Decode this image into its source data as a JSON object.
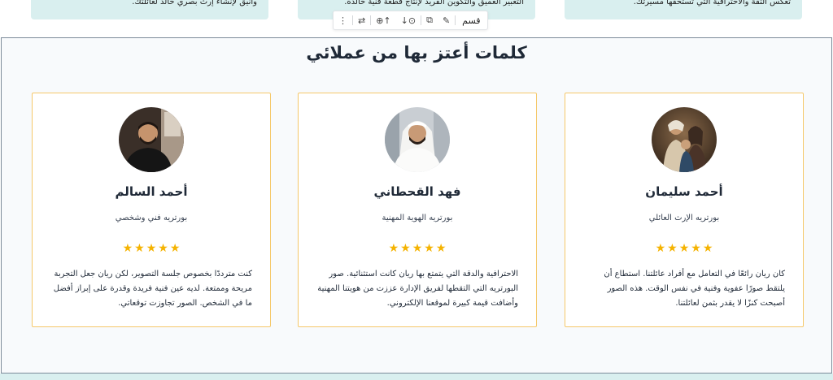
{
  "top_cards": [
    {
      "text": "تعكس الثقة والاحترافية التي تستحقها مسيرتك."
    },
    {
      "text": "التعبير العميق والتكوين الفريد لإنتاج قطعة فنية خالدة."
    },
    {
      "text": "وأنيق لإنشاء إرث بصري خالد لعائلتك."
    }
  ],
  "toolbar": {
    "label": "قسم",
    "edit_icon": "✎",
    "duplicate_icon": "⧉",
    "move_down_icon": "↓⊙",
    "move_up_icon": "⊕↑",
    "swap_icon": "⇄",
    "more_icon": "⋮"
  },
  "section": {
    "title": "كلمات أعتز بها من عملائي"
  },
  "testimonials": [
    {
      "name": "أحمد سليمان",
      "role": "بورتريه الإرث العائلي",
      "rating": 5,
      "quote": "كان ريان رائعًا في التعامل مع أفراد عائلتنا. استطاع أن يلتقط صورًا عفوية وفنية في نفس الوقت. هذه الصور أصبحت كنزًا لا يقدر بثمن لعائلتنا.",
      "avatar": "family-portrait-avatar"
    },
    {
      "name": "فهد القحطاني",
      "role": "بورتريه الهوية المهنية",
      "rating": 5,
      "quote": "الاحترافية والدقة التي يتمتع بها ريان كانت استثنائية. صور البورتريه التي التقطها لفريق الإدارة عززت من هويتنا المهنية وأضافت قيمة كبيرة لموقعنا الإلكتروني.",
      "avatar": "businessman-avatar"
    },
    {
      "name": "أحمد السالم",
      "role": "بورتريه فني وشخصي",
      "rating": 5,
      "quote": "كنت مترددًا بخصوص جلسة التصوير، لكن ريان جعل التجربة مريحة وممتعة. لديه عين فنية فريدة وقدرة على إبراز أفضل ما في الشخص. الصور تجاوزت توقعاتي.",
      "avatar": "man-portrait-avatar"
    }
  ],
  "star_glyph": "★",
  "colors": {
    "accent_border": "#f5c86a",
    "star": "#f5b301",
    "top_card_bg": "#d9efef",
    "section_bg": "#f8fafc"
  }
}
